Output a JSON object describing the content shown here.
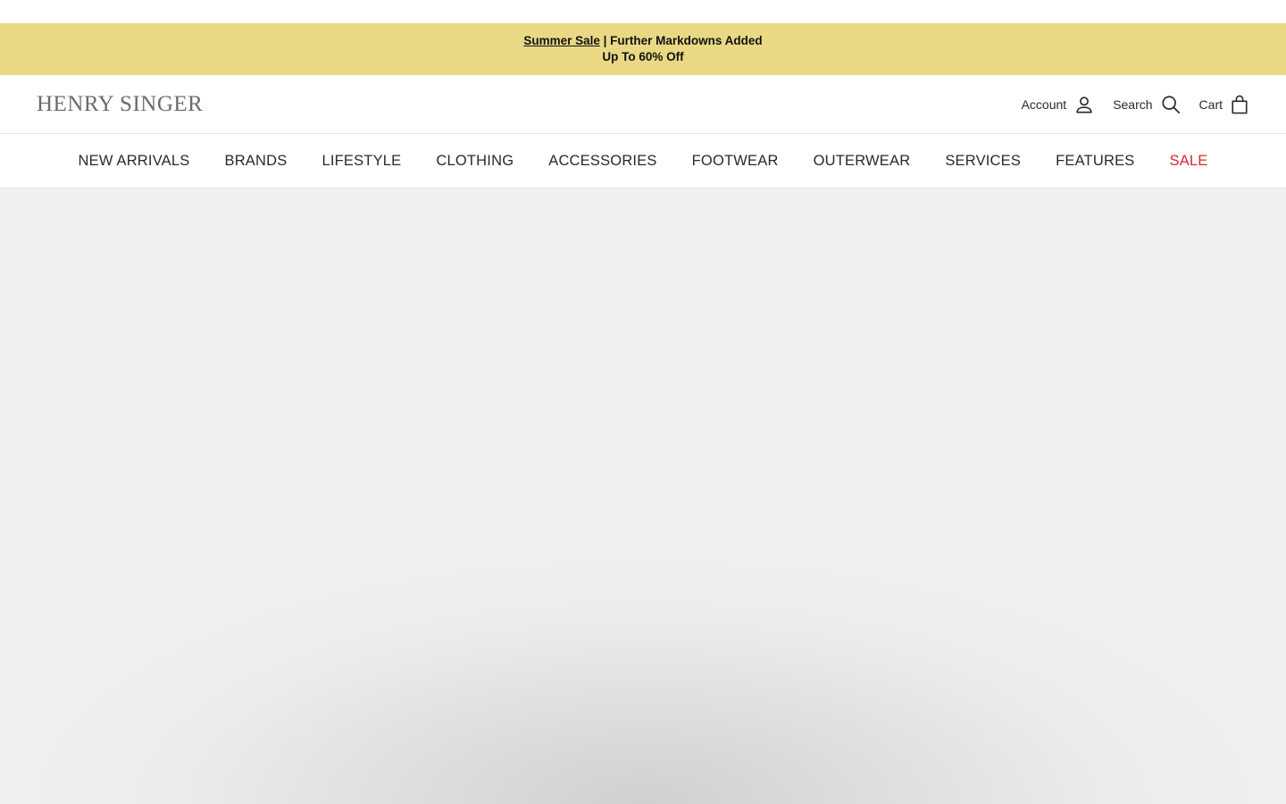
{
  "announcement": {
    "link_text": "Summer Sale",
    "line1_rest": " | Further Markdowns Added",
    "line2": "Up To 60% Off"
  },
  "header": {
    "logo": "HENRY SINGER",
    "account_label": "Account",
    "search_label": "Search",
    "cart_label": "Cart"
  },
  "nav": {
    "items": [
      {
        "label": "NEW ARRIVALS"
      },
      {
        "label": "BRANDS"
      },
      {
        "label": "LIFESTYLE"
      },
      {
        "label": "CLOTHING"
      },
      {
        "label": "ACCESSORIES"
      },
      {
        "label": "FOOTWEAR"
      },
      {
        "label": "OUTERWEAR"
      },
      {
        "label": "SERVICES"
      },
      {
        "label": "FEATURES"
      },
      {
        "label": "SALE"
      }
    ]
  },
  "colors": {
    "announcement_bg": "#e9d985",
    "sale": "#d7282f",
    "hero_bg": "#f0f0f0"
  },
  "icons": [
    "user-icon",
    "search-icon",
    "shopping-bag-icon"
  ]
}
